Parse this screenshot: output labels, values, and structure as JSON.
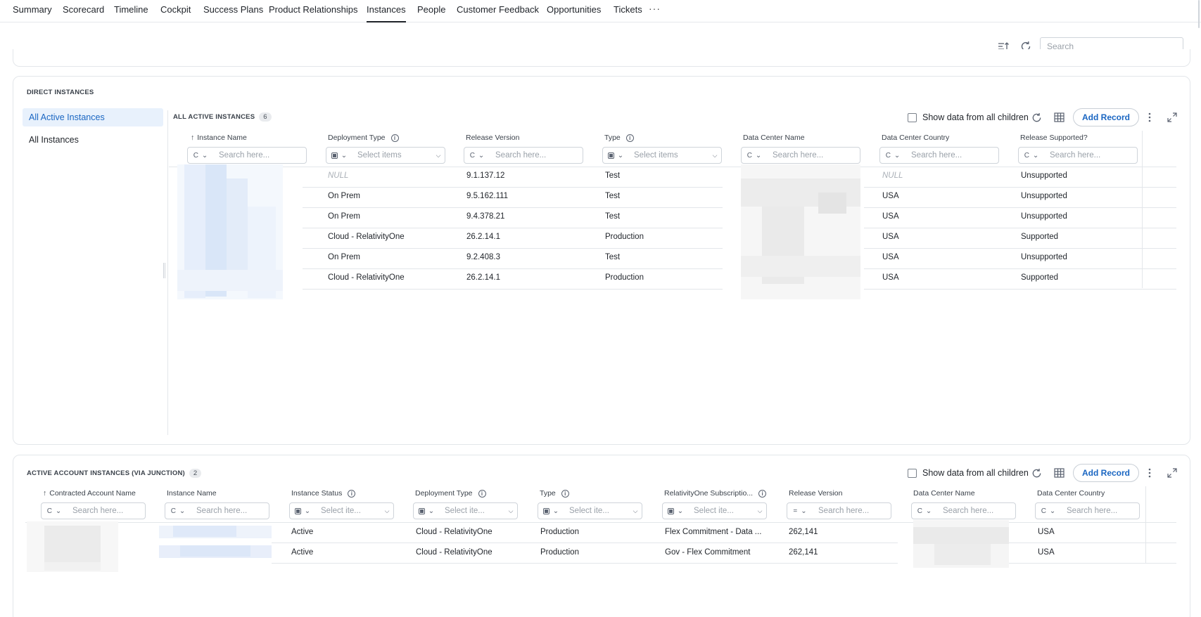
{
  "nav": {
    "tabs": [
      "Summary",
      "Scorecard",
      "Timeline",
      "Cockpit",
      "Success Plans",
      "Product Relationships",
      "Instances",
      "People",
      "Customer Feedback",
      "Opportunities",
      "Tickets"
    ],
    "active_tab": "Instances",
    "more": "···"
  },
  "toolbar": {
    "search_placeholder": "Search"
  },
  "direct": {
    "section_title": "DIRECT INSTANCES",
    "side_items": [
      "All Active Instances",
      "All Instances"
    ],
    "grid_title": "ALL ACTIVE INSTANCES",
    "count": "6",
    "show_children_label": "Show data from all children",
    "add_record_label": "Add Record",
    "columns": [
      {
        "label": "Instance Name",
        "sorted": "↑",
        "info": false,
        "filter": "Search here...",
        "op": "C",
        "kind": "text"
      },
      {
        "label": "Deployment Type",
        "info": true,
        "filter": "Select items",
        "kind": "select"
      },
      {
        "label": "Release Version",
        "info": false,
        "filter": "Search here...",
        "op": "C",
        "kind": "text"
      },
      {
        "label": "Type",
        "info": true,
        "filter": "Select items",
        "kind": "select"
      },
      {
        "label": "Data Center Name",
        "info": false,
        "filter": "Search here...",
        "op": "C",
        "kind": "text"
      },
      {
        "label": "Data Center Country",
        "info": false,
        "filter": "Search here...",
        "op": "C",
        "kind": "text"
      },
      {
        "label": "Release Supported?",
        "info": false,
        "filter": "Search here...",
        "op": "C",
        "kind": "text"
      }
    ],
    "rows": [
      {
        "deployment": "NULL",
        "release": "9.1.137.12",
        "type": "Test",
        "country": "NULL",
        "supported": "Unsupported"
      },
      {
        "deployment": "On Prem",
        "release": "9.5.162.111",
        "type": "Test",
        "country": "USA",
        "supported": "Unsupported"
      },
      {
        "deployment": "On Prem",
        "release": "9.4.378.21",
        "type": "Test",
        "country": "USA",
        "supported": "Unsupported"
      },
      {
        "deployment": "Cloud - RelativityOne",
        "release": "26.2.14.1",
        "type": "Production",
        "country": "USA",
        "supported": "Supported"
      },
      {
        "deployment": "On Prem",
        "release": "9.2.408.3",
        "type": "Test",
        "country": "USA",
        "supported": "Unsupported"
      },
      {
        "deployment": "Cloud - RelativityOne",
        "release": "26.2.14.1",
        "type": "Production",
        "country": "USA",
        "supported": "Supported"
      }
    ]
  },
  "junction": {
    "grid_title": "ACTIVE ACCOUNT INSTANCES (VIA JUNCTION)",
    "count": "2",
    "show_children_label": "Show data from all children",
    "add_record_label": "Add Record",
    "columns": [
      {
        "label": "Contracted Account Name",
        "sorted": "↑",
        "info": false,
        "filter": "Search here...",
        "op": "C",
        "kind": "text"
      },
      {
        "label": "Instance Name",
        "info": false,
        "filter": "Search here...",
        "op": "C",
        "kind": "text"
      },
      {
        "label": "Instance Status",
        "info": true,
        "filter": "Select ite...",
        "kind": "select"
      },
      {
        "label": "Deployment Type",
        "info": true,
        "filter": "Select ite...",
        "kind": "select"
      },
      {
        "label": "Type",
        "info": true,
        "filter": "Select ite...",
        "kind": "select"
      },
      {
        "label": "RelativityOne Subscriptio...",
        "info": true,
        "filter": "Select ite...",
        "kind": "select"
      },
      {
        "label": "Release Version",
        "info": false,
        "filter": "Search here...",
        "op": "=",
        "kind": "text"
      },
      {
        "label": "Data Center Name",
        "info": false,
        "filter": "Search here...",
        "op": "C",
        "kind": "text"
      },
      {
        "label": "Data Center Country",
        "info": false,
        "filter": "Search here...",
        "op": "C",
        "kind": "text"
      }
    ],
    "rows": [
      {
        "status": "Active",
        "deployment": "Cloud - RelativityOne",
        "type": "Production",
        "subscription": "Flex Commitment - Data ...",
        "release": "262,141",
        "country": "USA"
      },
      {
        "status": "Active",
        "deployment": "Cloud - RelativityOne",
        "type": "Production",
        "subscription": "Gov - Flex Commitment",
        "release": "262,141",
        "country": "USA"
      }
    ]
  },
  "colors": {
    "accent": "#1a66c2",
    "selected_bg": "#e8f1fc",
    "border": "#e3e6ea"
  }
}
